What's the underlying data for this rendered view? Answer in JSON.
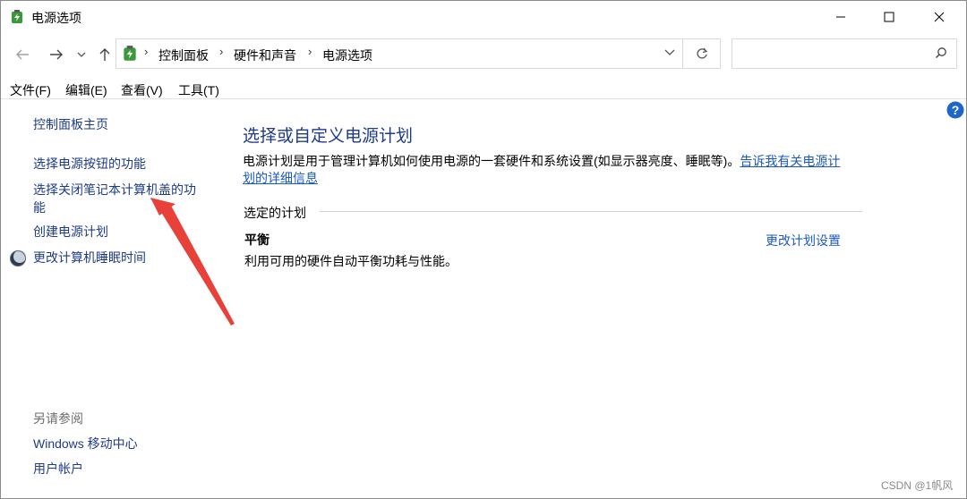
{
  "window": {
    "title": "电源选项"
  },
  "icons": {
    "app": "power-options-icon",
    "minimize": "minimize-icon",
    "maximize": "maximize-icon",
    "close": "close-icon",
    "back": "back-arrow-icon",
    "forward": "forward-arrow-icon",
    "recent": "chevron-down-icon",
    "up": "up-arrow-icon",
    "refresh": "refresh-icon",
    "search": "search-icon",
    "help": "help-icon",
    "sleep": "moon-icon"
  },
  "address": {
    "crumbs": [
      "控制面板",
      "硬件和声音",
      "电源选项"
    ]
  },
  "search": {
    "placeholder": ""
  },
  "menu": {
    "file": "文件(F)",
    "edit": "编辑(E)",
    "view": "查看(V)",
    "tools": "工具(T)"
  },
  "sidebar": {
    "home": "控制面板主页",
    "power_button": "选择电源按钮的功能",
    "lid_line1": "选择关闭笔记本计算机盖的功",
    "lid_line2": "能",
    "create_plan": "创建电源计划",
    "sleep_time": "更改计算机睡眠时间",
    "see_also": "另请参阅",
    "mobility_center": "Windows 移动中心",
    "user_accounts": "用户帐户"
  },
  "main": {
    "title": "选择或自定义电源计划",
    "desc_text": "电源计划是用于管理计算机如何使用电源的一套硬件和系统设置(如显示器亮度、睡眠等)。",
    "desc_link_a": "告诉我有关电源计",
    "desc_link_b": "划的详细信息",
    "group_label": "选定的计划",
    "plan_name": "平衡",
    "plan_desc": "利用可用的硬件自动平衡功耗与性能。",
    "plan_link": "更改计划设置"
  },
  "annotation": {
    "arrow_color": "#e8413a"
  },
  "colors": {
    "link": "#1a58c4",
    "nav_link": "#1e3b8a"
  },
  "watermark": "CSDN @1帆风"
}
